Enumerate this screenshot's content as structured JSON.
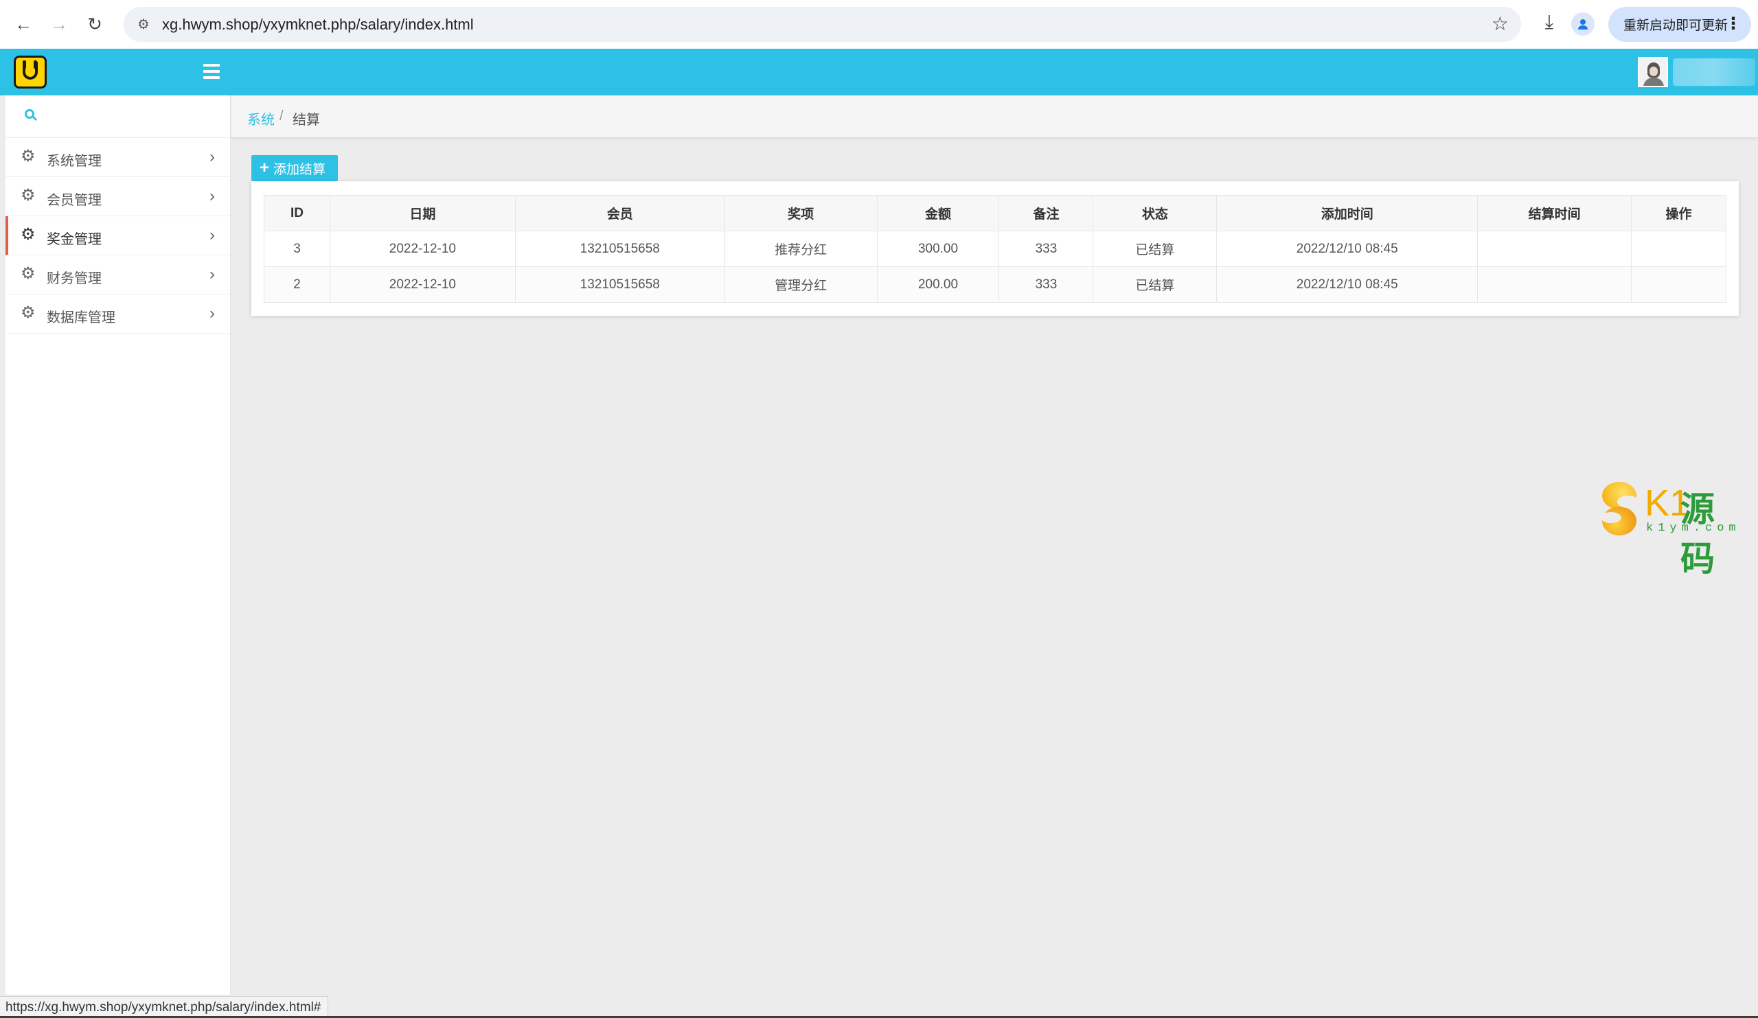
{
  "browser": {
    "url": "xg.hwym.shop/yxymknet.php/salary/index.html",
    "update_label": "重新启动即可更新",
    "status_url": "https://xg.hwym.shop/yxymknet.php/salary/index.html#"
  },
  "sidebar": {
    "items": [
      {
        "label": "系统管理",
        "icon": "gear-icon",
        "active": false
      },
      {
        "label": "会员管理",
        "icon": "gear-icon",
        "active": false
      },
      {
        "label": "奖金管理",
        "icon": "gear-icon",
        "active": true
      },
      {
        "label": "财务管理",
        "icon": "gear-icon",
        "active": false
      },
      {
        "label": "数据库管理",
        "icon": "gear-icon",
        "active": false
      }
    ]
  },
  "breadcrumb": {
    "root": "系统",
    "separator": "/",
    "current": "结算"
  },
  "toolbar": {
    "add_label": "添加结算"
  },
  "table": {
    "headers": [
      "ID",
      "日期",
      "会员",
      "奖项",
      "金额",
      "备注",
      "状态",
      "添加时间",
      "结算时间",
      "操作"
    ],
    "rows": [
      [
        "3",
        "2022-12-10",
        "13210515658",
        "推荐分红",
        "300.00",
        "333",
        "已结算",
        "2022/12/10 08:45",
        "",
        ""
      ],
      [
        "2",
        "2022-12-10",
        "13210515658",
        "管理分红",
        "200.00",
        "333",
        "已结算",
        "2022/12/10 08:45",
        "",
        ""
      ]
    ]
  },
  "watermark": {
    "brand_k": "K1",
    "brand_cn": "源码",
    "brand_url": "k1ym.com"
  },
  "colors": {
    "accent": "#2ec1e6",
    "active_marker": "#e25d4a"
  }
}
